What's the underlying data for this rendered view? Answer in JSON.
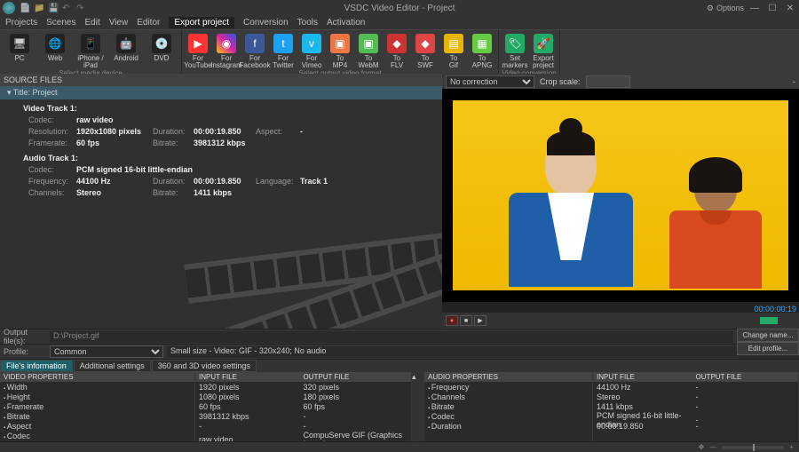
{
  "title": "VSDC Video Editor - Project",
  "options_label": "Options",
  "menubar": [
    "Projects",
    "Scenes",
    "Edit",
    "View",
    "Editor",
    "Export project",
    "Conversion",
    "Tools",
    "Activation"
  ],
  "menubar_active_index": 5,
  "ribbon": {
    "media": {
      "items": [
        "PC",
        "Web",
        "iPhone / iPad",
        "Android",
        "DVD"
      ],
      "label": "Select media device"
    },
    "formats": {
      "items": [
        {
          "l1": "For",
          "l2": "YouTube",
          "bg": "#f33",
          "glyph": "▶"
        },
        {
          "l1": "For",
          "l2": "Instagram",
          "bg": "linear-gradient(45deg,#f5c518,#d6249f,#285AEB)",
          "glyph": "◉"
        },
        {
          "l1": "For",
          "l2": "Facebook",
          "bg": "#3b5998",
          "glyph": "f"
        },
        {
          "l1": "For",
          "l2": "Twitter",
          "bg": "#1da1f2",
          "glyph": "t"
        },
        {
          "l1": "For",
          "l2": "Vimeo",
          "bg": "#1ab7ea",
          "glyph": "v"
        },
        {
          "l1": "To",
          "l2": "MP4",
          "bg": "#e74",
          "glyph": "▣"
        },
        {
          "l1": "To",
          "l2": "WebM",
          "bg": "#5b5",
          "glyph": "▣"
        },
        {
          "l1": "To",
          "l2": "FLV",
          "bg": "#c33",
          "glyph": "◆"
        },
        {
          "l1": "To",
          "l2": "SWF",
          "bg": "#d44",
          "glyph": "◆"
        },
        {
          "l1": "To",
          "l2": "Gif",
          "bg": "#e8b500",
          "glyph": "▤"
        },
        {
          "l1": "To",
          "l2": "APNG",
          "bg": "#6c4",
          "glyph": "▦"
        }
      ],
      "label": "Select output video format"
    },
    "conv": {
      "items": [
        {
          "l1": "Set",
          "l2": "markers"
        },
        {
          "l1": "Export",
          "l2": "project"
        }
      ],
      "label": "Video conversion"
    }
  },
  "source_files_label": "SOURCE FILES",
  "project_title": "Title: Project",
  "video_track": {
    "title": "Video Track 1:",
    "codec_lbl": "Codec:",
    "codec": "raw video",
    "res_lbl": "Resolution:",
    "res": "1920x1080 pixels",
    "dur_lbl": "Duration:",
    "dur": "00:00:19.850",
    "aspect_lbl": "Aspect:",
    "aspect": "-",
    "fr_lbl": "Framerate:",
    "fr": "60 fps",
    "br_lbl": "Bitrate:",
    "br": "3981312 kbps"
  },
  "audio_track": {
    "title": "Audio Track 1:",
    "codec_lbl": "Codec:",
    "codec": "PCM signed 16-bit little-endian",
    "freq_lbl": "Frequency:",
    "freq": "44100 Hz",
    "dur_lbl": "Duration:",
    "dur": "00:00:19.850",
    "lang_lbl": "Language:",
    "lang": "Track 1",
    "ch_lbl": "Channels:",
    "ch": "Stereo",
    "br_lbl": "Bitrate:",
    "br": "1411 kbps"
  },
  "crop": {
    "correction_value": "No correction",
    "scale_label": "Crop scale:"
  },
  "timecode": "00:00:00:19",
  "output": {
    "files_label": "Output file(s):",
    "file_value": "D:\\Project.gif",
    "profile_label": "Profile:",
    "profile_value": "Common",
    "profile_desc": "Small size - Video: GIF - 320x240; No audio",
    "change_name": "Change name...",
    "edit_profile": "Edit profile..."
  },
  "tabs": [
    "File's information",
    "Additional settings",
    "360 and 3D video settings"
  ],
  "tabs_active": 0,
  "video_props": {
    "header": "VIDEO PROPERTIES",
    "in_header": "INPUT FILE",
    "out_header": "OUTPUT FILE",
    "rows": [
      {
        "k": "Width",
        "in": "1920 pixels",
        "out": "320 pixels"
      },
      {
        "k": "Height",
        "in": "1080 pixels",
        "out": "180 pixels"
      },
      {
        "k": "Framerate",
        "in": "60 fps",
        "out": "60 fps"
      },
      {
        "k": "Bitrate",
        "in": "3981312 kbps",
        "out": "-"
      },
      {
        "k": "Aspect",
        "in": "-",
        "out": "-"
      },
      {
        "k": "Codec",
        "in": "raw video",
        "out": "CompuServe GIF (Graphics Interchange..."
      }
    ]
  },
  "audio_props": {
    "header": "AUDIO PROPERTIES",
    "in_header": "INPUT FILE",
    "out_header": "OUTPUT FILE",
    "rows": [
      {
        "k": "Frequency",
        "in": "44100 Hz",
        "out": "-"
      },
      {
        "k": "Channels",
        "in": "Stereo",
        "out": "-"
      },
      {
        "k": "Bitrate",
        "in": "1411 kbps",
        "out": "-"
      },
      {
        "k": "Codec",
        "in": "PCM signed 16-bit little-endian",
        "out": "-"
      },
      {
        "k": "Duration",
        "in": "00:00:19.850",
        "out": "-"
      }
    ]
  }
}
